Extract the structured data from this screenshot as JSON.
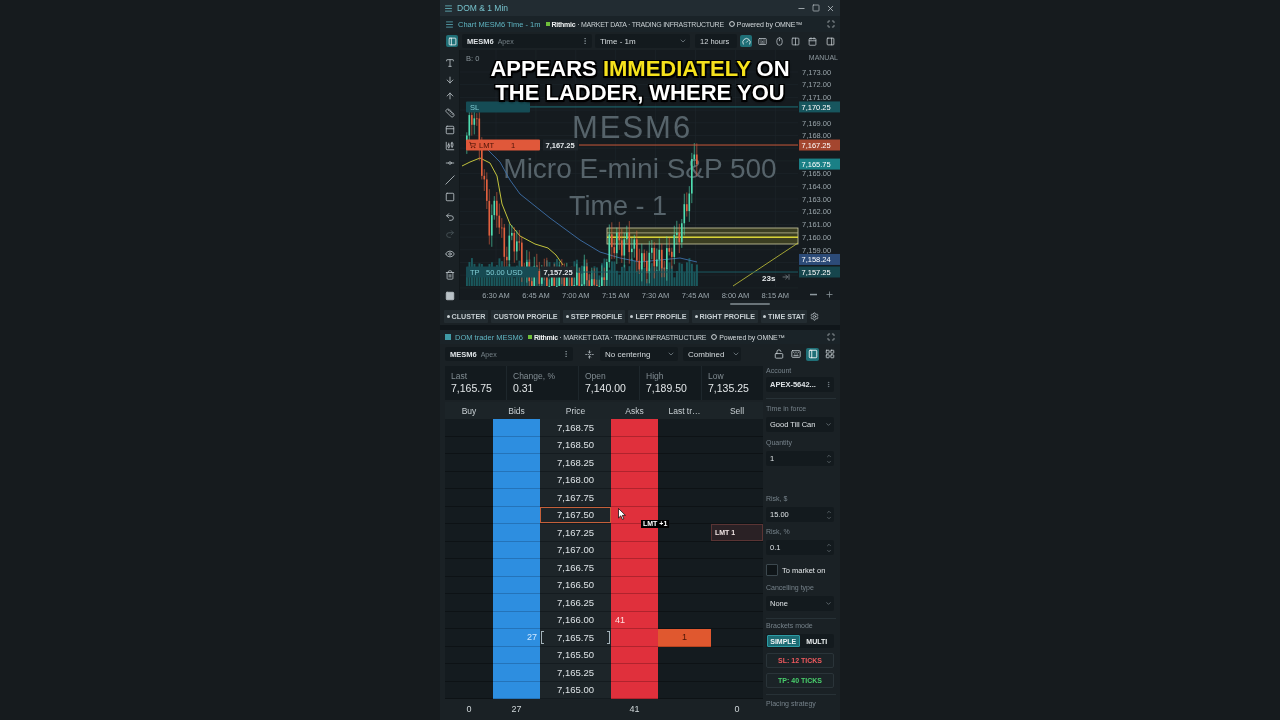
{
  "window": {
    "title": "DOM & 1 Min"
  },
  "chart_panel": {
    "title": "Chart MESM6 Time - 1m",
    "banner": "**Rithmic** · MARKET DATA · TRADING INFRASTRUCTURE",
    "powered_by": "Powered by OMNE™",
    "toolbar": {
      "symbol": "MESM6",
      "account": "Apex",
      "timeframe": "Time - 1m",
      "range": "12 hours",
      "tools": [
        {
          "kind": "gauge",
          "selected": true
        },
        {
          "kind": "keyboard",
          "selected": false
        },
        {
          "kind": "mouse",
          "selected": false
        },
        {
          "kind": "layout",
          "selected": false
        },
        {
          "kind": "calendar",
          "selected": false
        }
      ]
    },
    "draw_tools": [
      {
        "kind": "text",
        "disabled": false
      },
      {
        "kind": "arrow-down",
        "disabled": false
      },
      {
        "kind": "arrow-up",
        "disabled": false
      },
      {
        "kind": "ruler",
        "disabled": false
      },
      {
        "kind": "panel",
        "disabled": false
      },
      {
        "kind": "candlestick",
        "disabled": false
      },
      {
        "kind": "hline",
        "disabled": false
      },
      {
        "kind": "diagonal",
        "disabled": false
      },
      {
        "kind": "rectangle",
        "disabled": false
      },
      {
        "kind": "undo",
        "disabled": false
      },
      {
        "kind": "redo",
        "disabled": true
      },
      {
        "kind": "eye",
        "disabled": false
      },
      {
        "kind": "trash",
        "disabled": false
      },
      {
        "kind": "square",
        "disabled": false
      }
    ],
    "chart": {
      "info": "B: 0",
      "watermark": [
        "MESM6",
        "Micro E-mini S&P 500",
        "Time - 1"
      ],
      "axis_mode": "MANUAL",
      "price_ticks": [
        "7,173.00",
        "7,172.00",
        "7,171.00",
        "7,169.00",
        "7,168.00",
        "7,165.00",
        "7,164.00",
        "7,163.00",
        "7,162.00",
        "7,161.00",
        "7,160.00",
        "7,159.00"
      ],
      "price_tags": [
        {
          "kind": "last",
          "text": "7,165.75"
        },
        {
          "kind": "average",
          "text": "7,158.24"
        }
      ],
      "order_lines": [
        {
          "kind": "stop",
          "label": "SL",
          "tag": "7,170.25"
        },
        {
          "kind": "limit",
          "label": "LMT",
          "quantity": "1",
          "price": "7,167.25",
          "tag": "7,167.25"
        },
        {
          "kind": "target",
          "label": "TP",
          "amount": "50.00 USD",
          "price": "7,157.25",
          "tag": "7,157.25"
        }
      ],
      "time_labels": [
        "6:30 AM",
        "6:45 AM",
        "7:00 AM",
        "7:15 AM",
        "7:30 AM",
        "7:45 AM",
        "8:00 AM",
        "8:15 AM"
      ],
      "timer": "23s"
    },
    "tabs": [
      {
        "label": "CLUSTER",
        "dot": true
      },
      {
        "label": "CUSTOM PROFILE",
        "dot": false
      },
      {
        "label": "STEP PROFILE",
        "dot": true
      },
      {
        "label": "LEFT PROFILE",
        "dot": true
      },
      {
        "label": "RIGHT PROFILE",
        "dot": true
      },
      {
        "label": "TIME STAT",
        "dot": true
      }
    ]
  },
  "caption": {
    "lines": [
      [
        {
          "text": "APPEARS ",
          "highlight": false
        },
        {
          "text": "IMMEDIATELY",
          "highlight": true
        },
        {
          "text": " ON",
          "highlight": false
        }
      ],
      [
        {
          "text": "THE LADDER, WHERE YOU",
          "highlight": false
        }
      ]
    ]
  },
  "dom_panel": {
    "title": "DOM trader MESM6",
    "banner": "**Rithmic** · MARKET DATA · TRADING INFRASTRUCTURE",
    "powered_by": "Powered by OMNE™",
    "toolbar": {
      "symbol": "MESM6",
      "account": "Apex",
      "centering": "No centering",
      "mode": "Combined"
    },
    "stats": [
      {
        "label": "Last",
        "value": "7,165.75"
      },
      {
        "label": "Change, %",
        "value": "0.31"
      },
      {
        "label": "Open",
        "value": "7,140.00"
      },
      {
        "label": "High",
        "value": "7,189.50"
      },
      {
        "label": "Low",
        "value": "7,135.25"
      }
    ],
    "ladder": {
      "columns": [
        "Buy",
        "Bids",
        "Price",
        "Asks",
        "Last tr…",
        "Sell"
      ],
      "hover_tooltip": "LMT +1",
      "rows": [
        {
          "price": "7,168.75",
          "highlighted": false,
          "current": false
        },
        {
          "price": "7,168.50",
          "highlighted": false,
          "current": false
        },
        {
          "price": "7,168.25",
          "highlighted": false,
          "current": false
        },
        {
          "price": "7,168.00",
          "highlighted": false,
          "current": false
        },
        {
          "price": "7,167.75",
          "highlighted": false,
          "current": false
        },
        {
          "price": "7,167.50",
          "highlighted": true,
          "current": false
        },
        {
          "price": "7,167.25",
          "highlighted": false,
          "current": false,
          "sell_order": "LMT 1"
        },
        {
          "price": "7,167.00",
          "highlighted": false,
          "current": false
        },
        {
          "price": "7,166.75",
          "highlighted": false,
          "current": false
        },
        {
          "price": "7,166.50",
          "highlighted": false,
          "current": false
        },
        {
          "price": "7,166.25",
          "highlighted": false,
          "current": false
        },
        {
          "price": "7,166.00",
          "highlighted": false,
          "current": false,
          "ask": "41"
        },
        {
          "price": "7,165.75",
          "highlighted": false,
          "current": true,
          "bid": "27",
          "last": "1"
        },
        {
          "price": "7,165.50",
          "highlighted": false,
          "current": false
        },
        {
          "price": "7,165.25",
          "highlighted": false,
          "current": false
        },
        {
          "price": "7,165.00",
          "highlighted": false,
          "current": false
        }
      ],
      "totals": {
        "buy": "0",
        "bids": "27",
        "asks": "41",
        "sell": "0"
      }
    },
    "order_panel": {
      "view_buttons": [
        {
          "kind": "lock",
          "selected": false
        },
        {
          "kind": "keyboard",
          "selected": false
        },
        {
          "kind": "panel",
          "selected": true
        },
        {
          "kind": "grid",
          "selected": false
        }
      ],
      "account": {
        "label": "Account",
        "value": "APEX-5642..."
      },
      "time_in_force": {
        "label": "Time in force",
        "value": "Good Till Can"
      },
      "quantity": {
        "label": "Quantity",
        "value": "1"
      },
      "risk": [
        {
          "label": "Risk, $",
          "value": "15.00"
        },
        {
          "label": "Risk, %",
          "value": "0.1"
        }
      ],
      "to_market": {
        "label": "To market on",
        "checked": false
      },
      "cancelling": {
        "label": "Cancelling type",
        "value": "None"
      },
      "brackets": {
        "label": "Brackets mode",
        "modes": [
          {
            "label": "SIMPLE",
            "selected": true
          },
          {
            "label": "MULTI",
            "selected": false
          }
        ],
        "stop_loss": "SL: 12 TICKS",
        "take_profit": "TP: 40 TICKS"
      },
      "placing_strategy": "Placing strategy"
    }
  }
}
